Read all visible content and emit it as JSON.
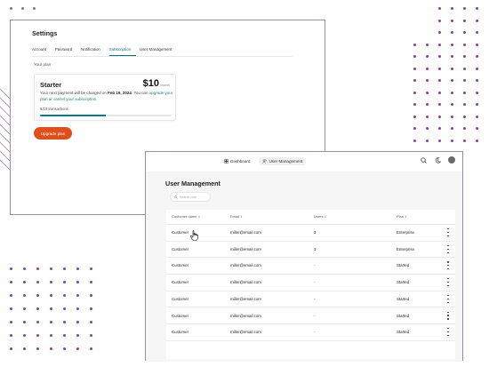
{
  "settings": {
    "title": "Settings",
    "tabs": [
      "Account",
      "Password",
      "Notification",
      "Subscription",
      "User Management"
    ],
    "active_tab": "Subscription",
    "your_plan_label": "Your plan",
    "plan": {
      "name": "Starter",
      "price": "$10",
      "period": "/month",
      "desc_prefix": "Your next payment will be charged on ",
      "desc_date": "Feb 19, 2024",
      "desc_mid": ". You can ",
      "desc_link1": "upgrade your plan",
      "desc_or": " or ",
      "desc_link2": "cancel your subscription",
      "desc_end": ".",
      "usage": "5/10 transactions",
      "usage_fraction": 0.5
    },
    "upgrade_button": "Upgrade plan"
  },
  "user_management": {
    "nav": {
      "dashboard": "Dashboard",
      "user_management": "User Management"
    },
    "title": "User Management",
    "search_placeholder": "Search user",
    "columns": [
      "Customer name",
      "Email",
      "Users",
      "Plan"
    ],
    "rows": [
      {
        "name": "Customer",
        "email": "miller@email.com",
        "users": "3",
        "plan": "Enterprise"
      },
      {
        "name": "Customer",
        "email": "miller@email.com",
        "users": "3",
        "plan": "Enterprise"
      },
      {
        "name": "Customer",
        "email": "miller@email.com",
        "users": "-",
        "plan": "Started"
      },
      {
        "name": "Customer",
        "email": "miller@email.com",
        "users": "-",
        "plan": "Started"
      },
      {
        "name": "Customer",
        "email": "miller@email.com",
        "users": "-",
        "plan": "Started"
      },
      {
        "name": "Customer",
        "email": "miller@email.com",
        "users": "-",
        "plan": "Started"
      },
      {
        "name": "Customer",
        "email": "miller@email.com",
        "users": "-",
        "plan": "Started"
      }
    ]
  },
  "colors": {
    "accent": "#0d6e7a",
    "button": "#e04e1b",
    "frame_border": "#9a8ea8",
    "dot_purple": "#8a3fa0",
    "dot_gray": "#7b7f86"
  }
}
